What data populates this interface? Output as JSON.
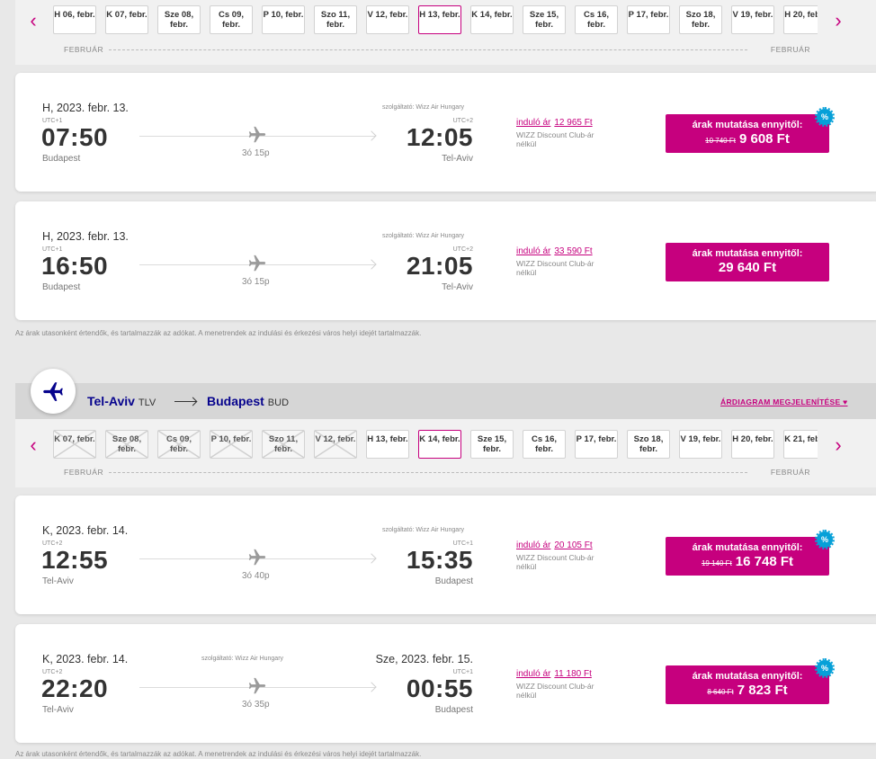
{
  "outbound": {
    "dates": [
      {
        "label": "H 06, febr.",
        "state": "normal"
      },
      {
        "label": "K 07, febr.",
        "state": "normal"
      },
      {
        "label": "Sze 08, febr.",
        "state": "normal"
      },
      {
        "label": "Cs 09, febr.",
        "state": "normal"
      },
      {
        "label": "P 10, febr.",
        "state": "normal"
      },
      {
        "label": "Szo 11, febr.",
        "state": "normal"
      },
      {
        "label": "V 12, febr.",
        "state": "normal"
      },
      {
        "label": "H 13, febr.",
        "state": "selected"
      },
      {
        "label": "K 14, febr.",
        "state": "normal"
      },
      {
        "label": "Sze 15, febr.",
        "state": "normal"
      },
      {
        "label": "Cs 16, febr.",
        "state": "normal"
      },
      {
        "label": "P 17, febr.",
        "state": "normal"
      },
      {
        "label": "Szo 18, febr.",
        "state": "normal"
      },
      {
        "label": "V 19, febr.",
        "state": "normal"
      },
      {
        "label": "H 20, febr.",
        "state": "normal"
      }
    ],
    "month_left": "FEBRUÁR",
    "month_right": "FEBRUÁR",
    "flights": [
      {
        "dep_date": "H, 2023. febr. 13.",
        "arr_date": "",
        "operator": "szolgáltató: Wizz Air Hungary",
        "dep_utc": "UTC+1",
        "arr_utc": "UTC+2",
        "dep_time": "07:50",
        "arr_time": "12:05",
        "dep_city": "Budapest",
        "arr_city": "Tel-Aviv",
        "duration": "3ó 15p",
        "start_label": "induló ár",
        "start_price": "12 965 Ft",
        "club_note": "WIZZ Discount Club-ár nélkül",
        "btn_label": "árak mutatása ennyitől:",
        "old_price": "10 740 Ft",
        "new_price": "9 608 Ft",
        "badge": "%"
      },
      {
        "dep_date": "H, 2023. febr. 13.",
        "arr_date": "",
        "operator": "szolgáltató: Wizz Air Hungary",
        "dep_utc": "UTC+1",
        "arr_utc": "UTC+2",
        "dep_time": "16:50",
        "arr_time": "21:05",
        "dep_city": "Budapest",
        "arr_city": "Tel-Aviv",
        "duration": "3ó 15p",
        "start_label": "induló ár",
        "start_price": "33 590 Ft",
        "club_note": "WIZZ Discount Club-ár nélkül",
        "btn_label": "árak mutatása ennyitől:",
        "old_price": "",
        "new_price": "29 640 Ft",
        "badge": ""
      }
    ],
    "footnote": "Az árak utasonként értendők, és tartalmazzák az adókat. A menetrendek az indulási és érkezési város helyi idejét tartalmazzák."
  },
  "return_route": {
    "from_city": "Tel-Aviv",
    "from_code": "TLV",
    "to_city": "Budapest",
    "to_code": "BUD",
    "chart_link": "ÁRDIAGRAM MEGJELENÍTÉSE ♥"
  },
  "inbound": {
    "dates": [
      {
        "label": "K 07, febr.",
        "state": "disabled"
      },
      {
        "label": "Sze 08, febr.",
        "state": "disabled"
      },
      {
        "label": "Cs 09, febr.",
        "state": "disabled"
      },
      {
        "label": "P 10, febr.",
        "state": "disabled"
      },
      {
        "label": "Szo 11, febr.",
        "state": "disabled"
      },
      {
        "label": "V 12, febr.",
        "state": "disabled"
      },
      {
        "label": "H 13, febr.",
        "state": "normal"
      },
      {
        "label": "K 14, febr.",
        "state": "selected"
      },
      {
        "label": "Sze 15, febr.",
        "state": "normal"
      },
      {
        "label": "Cs 16, febr.",
        "state": "normal"
      },
      {
        "label": "P 17, febr.",
        "state": "normal"
      },
      {
        "label": "Szo 18, febr.",
        "state": "normal"
      },
      {
        "label": "V 19, febr.",
        "state": "normal"
      },
      {
        "label": "H 20, febr.",
        "state": "normal"
      },
      {
        "label": "K 21, febr.",
        "state": "normal"
      }
    ],
    "month_left": "FEBRUÁR",
    "month_right": "FEBRUÁR",
    "flights": [
      {
        "dep_date": "K, 2023. febr. 14.",
        "arr_date": "",
        "operator": "szolgáltató: Wizz Air Hungary",
        "dep_utc": "UTC+2",
        "arr_utc": "UTC+1",
        "dep_time": "12:55",
        "arr_time": "15:35",
        "dep_city": "Tel-Aviv",
        "arr_city": "Budapest",
        "duration": "3ó 40p",
        "start_label": "induló ár",
        "start_price": "20 105 Ft",
        "club_note": "WIZZ Discount Club-ár nélkül",
        "btn_label": "árak mutatása ennyitől:",
        "old_price": "19 140 Ft",
        "new_price": "16 748 Ft",
        "badge": "%"
      },
      {
        "dep_date": "K, 2023. febr. 14.",
        "arr_date": "Sze, 2023. febr. 15.",
        "operator": "szolgáltató: Wizz Air Hungary",
        "dep_utc": "UTC+2",
        "arr_utc": "UTC+1",
        "dep_time": "22:20",
        "arr_time": "00:55",
        "dep_city": "Tel-Aviv",
        "arr_city": "Budapest",
        "duration": "3ó 35p",
        "start_label": "induló ár",
        "start_price": "11 180 Ft",
        "club_note": "WIZZ Discount Club-ár nélkül",
        "btn_label": "árak mutatása ennyitől:",
        "old_price": "8 640 Ft",
        "new_price": "7 823 Ft",
        "badge": "%"
      }
    ],
    "footnote": "Az árak utasonként értendők, és tartalmazzák az adókat. A menetrendek az indulási és érkezési város helyi idejét tartalmazzák."
  },
  "colors": {
    "accent": "#c6007e",
    "brand": "#06038d",
    "badge": "#06a0d8"
  },
  "icons": {
    "prev": "chevron-left-icon",
    "next": "chevron-right-icon",
    "plane": "plane-icon",
    "route": "plane-icon"
  }
}
